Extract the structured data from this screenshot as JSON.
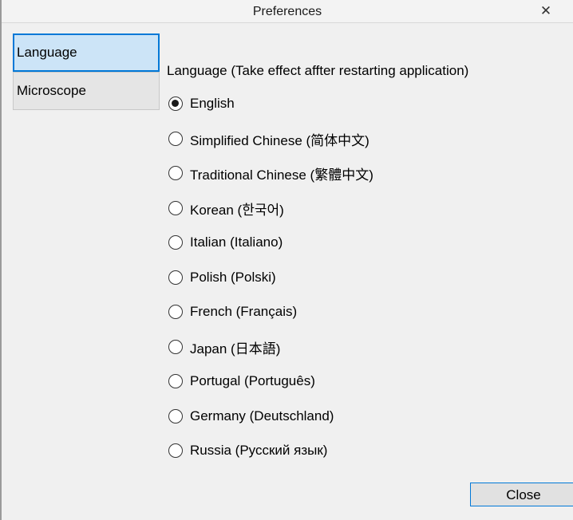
{
  "window": {
    "title": "Preferences",
    "close_glyph": "✕"
  },
  "sidebar": {
    "items": [
      {
        "label": "Language",
        "selected": true
      },
      {
        "label": "Microscope",
        "selected": false
      }
    ]
  },
  "language": {
    "group_label": "Language (Take effect affter restarting application)",
    "selected": "English",
    "options": [
      {
        "label": "English",
        "checked": true
      },
      {
        "label": "Simplified Chinese (简体中文)",
        "checked": false
      },
      {
        "label": "Traditional Chinese (繁體中文)",
        "checked": false
      },
      {
        "label": "Korean (한국어)",
        "checked": false
      },
      {
        "label": "Italian (Italiano)",
        "checked": false
      },
      {
        "label": "Polish (Polski)",
        "checked": false
      },
      {
        "label": "French (Français)",
        "checked": false
      },
      {
        "label": "Japan (日本語)",
        "checked": false
      },
      {
        "label": "Portugal (Português)",
        "checked": false
      },
      {
        "label": "Germany (Deutschland)",
        "checked": false
      },
      {
        "label": "Russia (Русский язык)",
        "checked": false
      }
    ]
  },
  "footer": {
    "close_label": "Close"
  },
  "colors": {
    "selection_bg": "#cce4f7",
    "selection_border": "#0078d7",
    "window_bg": "#f0f0f0"
  }
}
